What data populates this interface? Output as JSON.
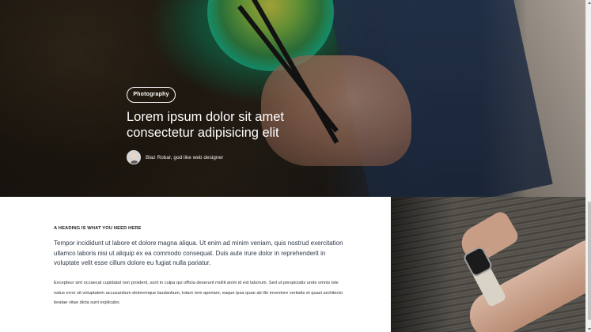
{
  "hero": {
    "category_label": "Photography",
    "title": "Lorem ipsum dolor sit amet consectetur adipisicing elit",
    "author": "Blaz Robar, god like web designer"
  },
  "article": {
    "section_heading": "A HEADING IS WHAT YOU NEED HERE",
    "lead": "Tempor incididunt ut labore et dolore magna aliqua. Ut enim ad minim veniam, quis nostrud exercitation ullamco laboris nisi ut aliquip ex ea commodo consequat. Duis aute irure dolor in reprehenderit in voluptate velit esse cillum dolore eu fugiat nulla pariatur.",
    "body": "Excepteur sint occaecat cupidatat non proident, sunt in culpa qui officia deserunt mollit anim id est laborum. Sed ut perspiciatis unde omnis iste natus error sit voluptatem accusantium doloremque laudantium, totam rem aperiam, eaque ipsa quae ab illo inventore veritatis et quasi architecto beatae vitae dicta sunt explicabo."
  },
  "icons": {
    "scroll_up": "arrow-up-icon",
    "scroll_down": "arrow-down-icon"
  }
}
